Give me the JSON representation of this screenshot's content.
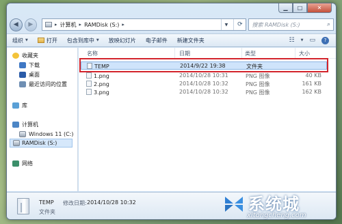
{
  "window": {
    "caption_buttons": {
      "minimize": "▁",
      "maximize": "□",
      "close": "✕"
    }
  },
  "address_bar": {
    "back_icon": "◀",
    "forward_icon": "▶",
    "breadcrumbs": [
      "计算机",
      "RAMDisk (S:)"
    ],
    "search_placeholder": "搜索 RAMDisk (S:)"
  },
  "toolbar": {
    "organize": "组织",
    "open": "打开",
    "include_in_library": "包含到库中",
    "slideshow": "放映幻灯片",
    "email": "电子邮件",
    "new_folder": "新建文件夹"
  },
  "nav_pane": {
    "favorites": "收藏夹",
    "downloads": "下载",
    "desktop": "桌面",
    "recent": "最近访问的位置",
    "libraries": "库",
    "computer": "计算机",
    "drive_c": "Windows 11 (C:)",
    "drive_s": "RAMDisk (S:)",
    "network": "网络"
  },
  "columns": {
    "name": "名称",
    "date": "日期",
    "type": "类型",
    "size": "大小"
  },
  "files": [
    {
      "name": "TEMP",
      "date": "2014/9/22 19:38",
      "type": "文件夹",
      "size": ""
    },
    {
      "name": "1.png",
      "date": "2014/10/28 10:31",
      "type": "PNG 图像",
      "size": "40 KB"
    },
    {
      "name": "2.png",
      "date": "2014/10/28 10:32",
      "type": "PNG 图像",
      "size": "161 KB"
    },
    {
      "name": "3.png",
      "date": "2014/10/28 10:32",
      "type": "PNG 图像",
      "size": "162 KB"
    }
  ],
  "details": {
    "name": "TEMP",
    "modified_label": "修改日期:",
    "modified": "2014/10/28 10:32",
    "type": "文件夹"
  },
  "watermark": {
    "text": "系统城",
    "url": "xitongcheng.com"
  },
  "colors": {
    "highlight": "#d3232b",
    "selection": "#cfe4fb"
  }
}
